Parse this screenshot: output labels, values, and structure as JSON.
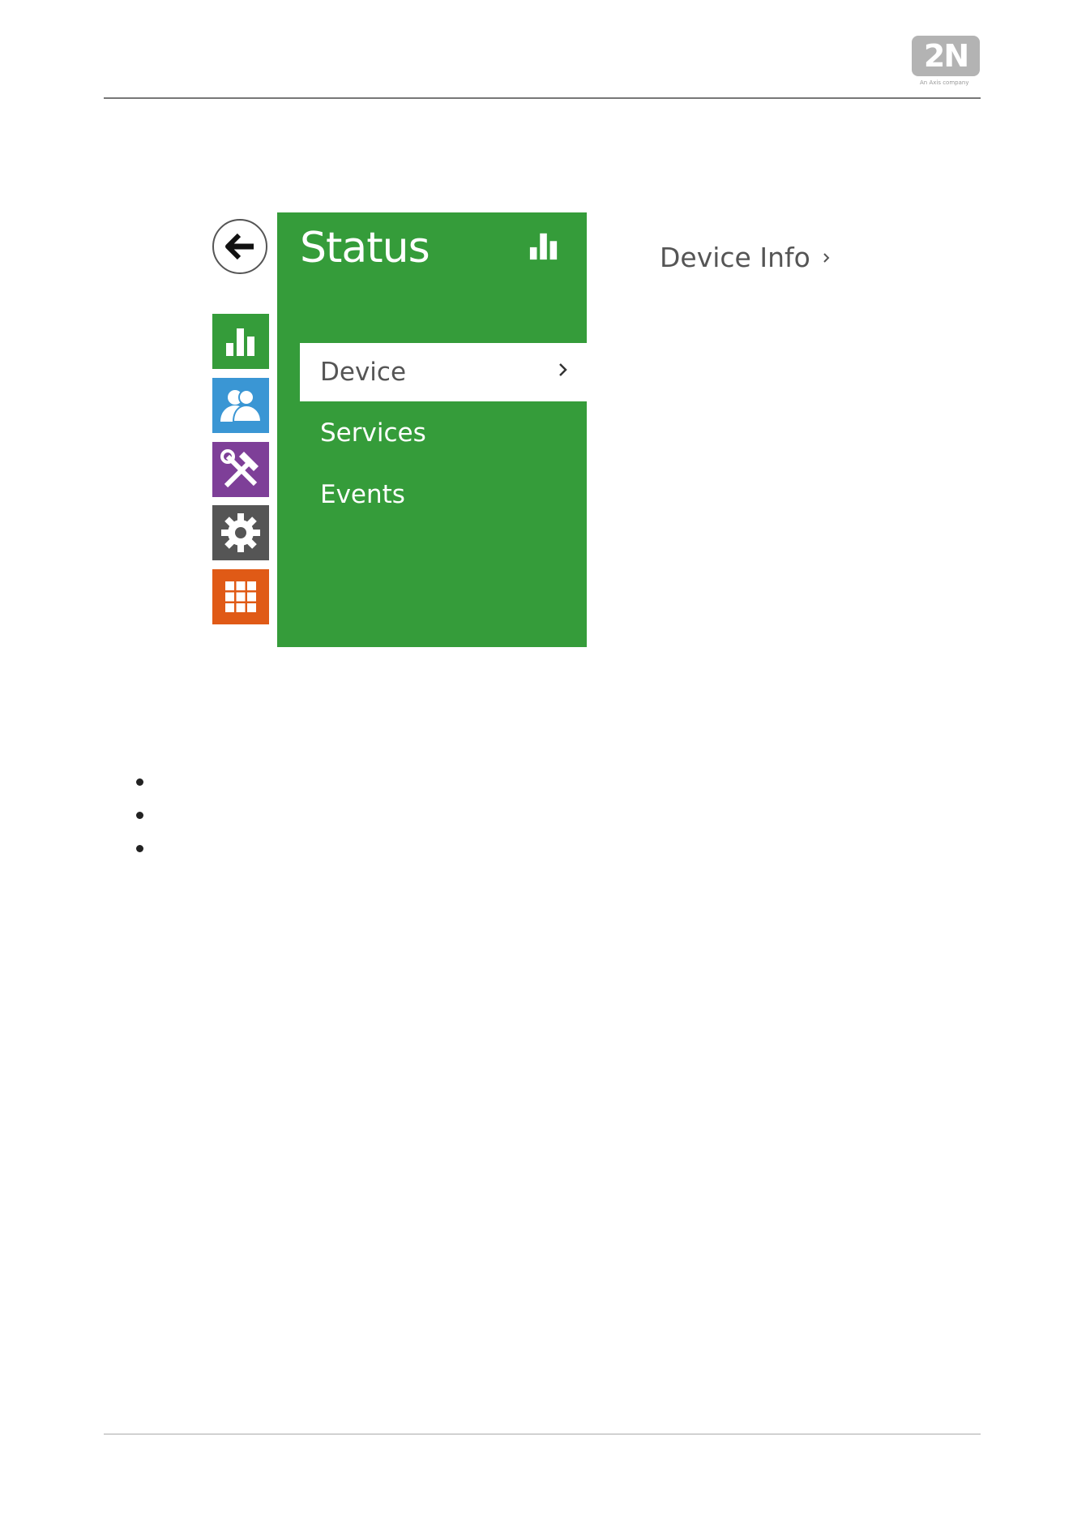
{
  "header": {
    "logo_text": "2N",
    "logo_subtitle": "An Axis company"
  },
  "sidebar": {
    "back_icon": "arrow-left-icon",
    "items": [
      {
        "icon": "bar-chart-icon",
        "color": "#359c3a"
      },
      {
        "icon": "users-icon",
        "color": "#3a96d4"
      },
      {
        "icon": "tools-icon",
        "color": "#7e3f98"
      },
      {
        "icon": "gear-icon",
        "color": "#555555"
      },
      {
        "icon": "grid-icon",
        "color": "#e05a16"
      }
    ]
  },
  "panel": {
    "title": "Status",
    "icon": "bar-chart-icon",
    "menu": [
      {
        "label": "Device",
        "active": true
      },
      {
        "label": "Services",
        "active": false
      },
      {
        "label": "Events",
        "active": false
      }
    ]
  },
  "content": {
    "link_label": "Device Info"
  },
  "bullets": [
    "",
    "",
    ""
  ]
}
